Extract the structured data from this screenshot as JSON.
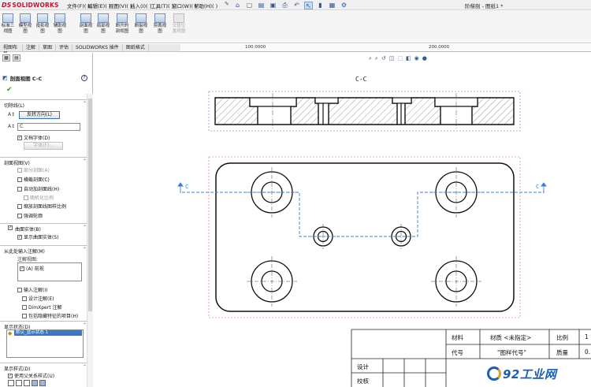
{
  "app": {
    "logo_ds": "DS",
    "logo_name": "SOLIDWORKS",
    "doc_title": "阶梯剖 - 图纸1 *"
  },
  "menu": [
    {
      "label": "文件(F)"
    },
    {
      "label": "编辑(E)"
    },
    {
      "label": "视图(V)"
    },
    {
      "label": "插入(I)"
    },
    {
      "label": "工具(T)"
    },
    {
      "label": "窗口(W)"
    },
    {
      "label": "帮助(H)"
    }
  ],
  "ribbon": [
    {
      "label": "标准三视图",
      "icon": "three-view-icon",
      "enabled": true
    },
    {
      "label": "模型视图",
      "icon": "model-view-icon",
      "enabled": true
    },
    {
      "label": "投影视图",
      "icon": "projected-view-icon",
      "enabled": true
    },
    {
      "label": "辅助视图",
      "icon": "auxiliary-view-icon",
      "enabled": true
    },
    {
      "label": "剖面视图",
      "icon": "section-view-icon",
      "enabled": true
    },
    {
      "label": "局部视图",
      "icon": "detail-view-icon",
      "enabled": true
    },
    {
      "label": "断开的剖视图",
      "icon": "broken-out-section-icon",
      "enabled": true
    },
    {
      "label": "断裂视图",
      "icon": "break-view-icon",
      "enabled": true
    },
    {
      "label": "剪裁视图",
      "icon": "crop-view-icon",
      "enabled": true
    },
    {
      "label": "交替位置视图",
      "icon": "alternate-position-icon",
      "enabled": false
    }
  ],
  "tabs": [
    {
      "label": "视图布局"
    },
    {
      "label": "注解"
    },
    {
      "label": "草图"
    },
    {
      "label": "评估"
    },
    {
      "label": "SOLIDWORKS 插件"
    },
    {
      "label": "图纸格式"
    }
  ],
  "ruler": {
    "marks": [
      "100.0000",
      "200.0000"
    ]
  },
  "pm": {
    "title": "剖面视图 C-C",
    "help": "?",
    "cutting_line": {
      "header": "切除线(L)",
      "flip_button": "反转方向(L)",
      "label_value": "C",
      "doc_font": "文档字体(D)",
      "font_button": "字体(F)..."
    },
    "section_view": {
      "header": "剖面视图(V)",
      "options": [
        {
          "label": "部分剖面(A)",
          "checked": false,
          "enabled": false
        },
        {
          "label": "横截剖面(C)",
          "checked": false,
          "enabled": true
        },
        {
          "label": "自动加剖面线(H)",
          "checked": false,
          "enabled": true
        },
        {
          "label": "随机化比例",
          "checked": false,
          "enabled": false
        },
        {
          "label": "缩放剖面线图样比例",
          "checked": false,
          "enabled": true
        },
        {
          "label": "强调轮廓",
          "checked": false,
          "enabled": true
        }
      ]
    },
    "surface_bodies": {
      "header": "曲面实体(B)",
      "checked": true,
      "option": "显示曲面实体(S)"
    },
    "import_annotations": {
      "header": "从此处输入注解(M)",
      "views_label": "注解视图:",
      "views": [
        {
          "label": "(A) 前视",
          "checked": true
        }
      ],
      "import_label": "输入注解(I)",
      "options": [
        {
          "label": "设计注解(E)",
          "checked": false
        },
        {
          "label": "DimXpert 注解",
          "checked": false
        },
        {
          "label": "包括隐藏特征的项目(H)",
          "checked": false
        }
      ]
    },
    "display_state": {
      "header": "显示状态(D)",
      "selected": "默认_显示状态 1"
    },
    "display_style": {
      "header": "显示样式(D)",
      "option": "使用父关系样式(U)"
    }
  },
  "view_tools": [
    "zoom-fit-icon",
    "zoom-area-icon",
    "previous-view-icon",
    "section-icon",
    "view-orientation-icon",
    "display-style-icon",
    "hide-show-icon",
    "appearance-icon"
  ],
  "drawing": {
    "section_label": "C-C",
    "cut_labels": [
      "C",
      "C"
    ]
  },
  "title_block": {
    "material_label": "材料",
    "material_value": "材质 <未指定>",
    "scale_label": "比例",
    "scale_value": "1",
    "code_label": "代号",
    "code_value": "\"图样代号\"",
    "mass_label": "质量",
    "mass_value": "0.",
    "design_label": "设计",
    "check_label": "校核"
  },
  "watermark": {
    "text": "92工业网"
  },
  "colors": {
    "accent": "#3978c6",
    "brand_red": "#c8102e",
    "hidden_line": "#3b7fd8",
    "boundary": "#e06060"
  }
}
